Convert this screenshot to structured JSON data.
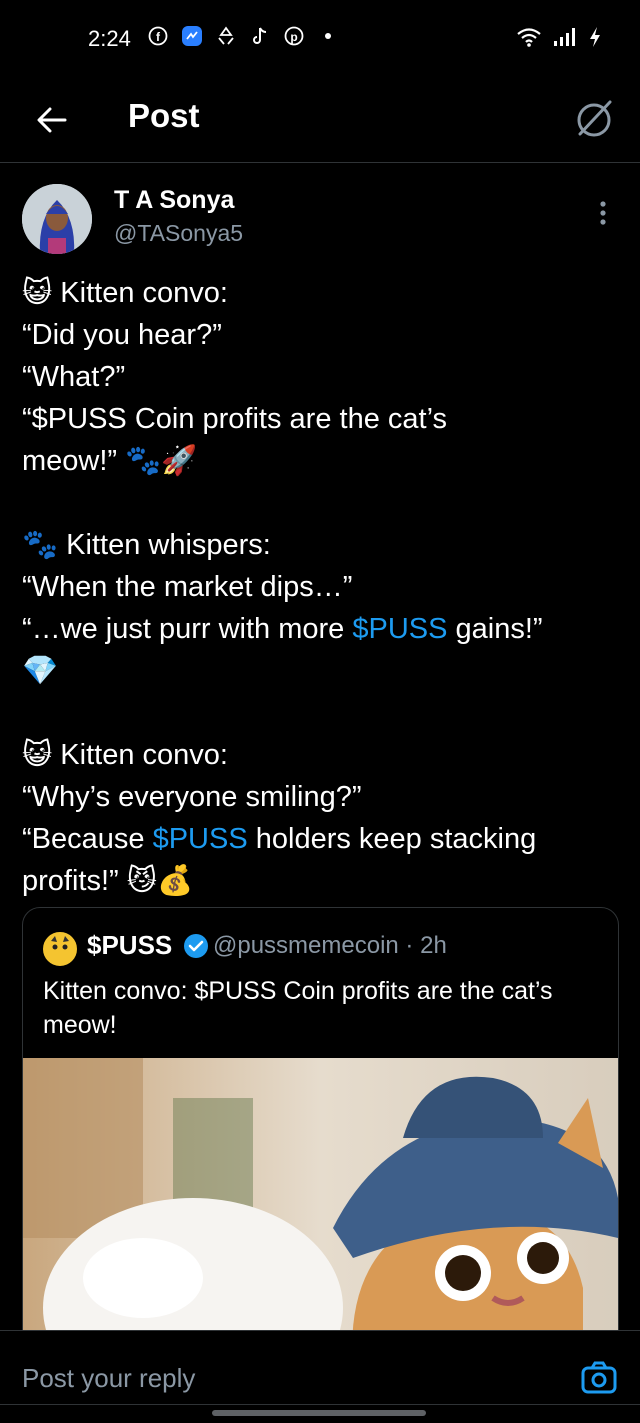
{
  "status_bar": {
    "time": "2:24",
    "icons": [
      "facebook-icon",
      "messenger-icon",
      "recycle-icon",
      "tiktok-icon",
      "pinterest-icon",
      "dot-icon"
    ],
    "right_icons": [
      "wifi-icon",
      "signal-icon",
      "charging-icon"
    ]
  },
  "header": {
    "title": "Post"
  },
  "post": {
    "author_name": "T A Sonya",
    "author_handle": "@TASonya5",
    "paragraphs": [
      [
        "😺 Kitten convo:",
        "“Did you hear?”",
        "“What?”",
        "“$PUSS Coin profits are the cat’s",
        "meow!” 🐾🚀"
      ],
      [
        "🐾 Kitten whispers:",
        "“When the market dips…”",
        "“…we just purr with more ",
        "$PUSS",
        " gains!”",
        "💎"
      ],
      [
        "😺 Kitten convo:",
        "“Why’s everyone smiling?”",
        "“Because ",
        "$PUSS",
        " holders keep stacking",
        "profits!” 😼💰"
      ]
    ]
  },
  "quote": {
    "name": "$PUSS",
    "handle": "@pussmemecoin · 2h",
    "text": "Kitten convo: $PUSS Coin profits are the cat’s meow!"
  },
  "reply": {
    "placeholder": "Post your reply"
  },
  "colors": {
    "background": "#000000",
    "text": "#ffffff",
    "muted": "#8b98a5",
    "accent": "#1d9bf0",
    "border": "#2f3336"
  }
}
